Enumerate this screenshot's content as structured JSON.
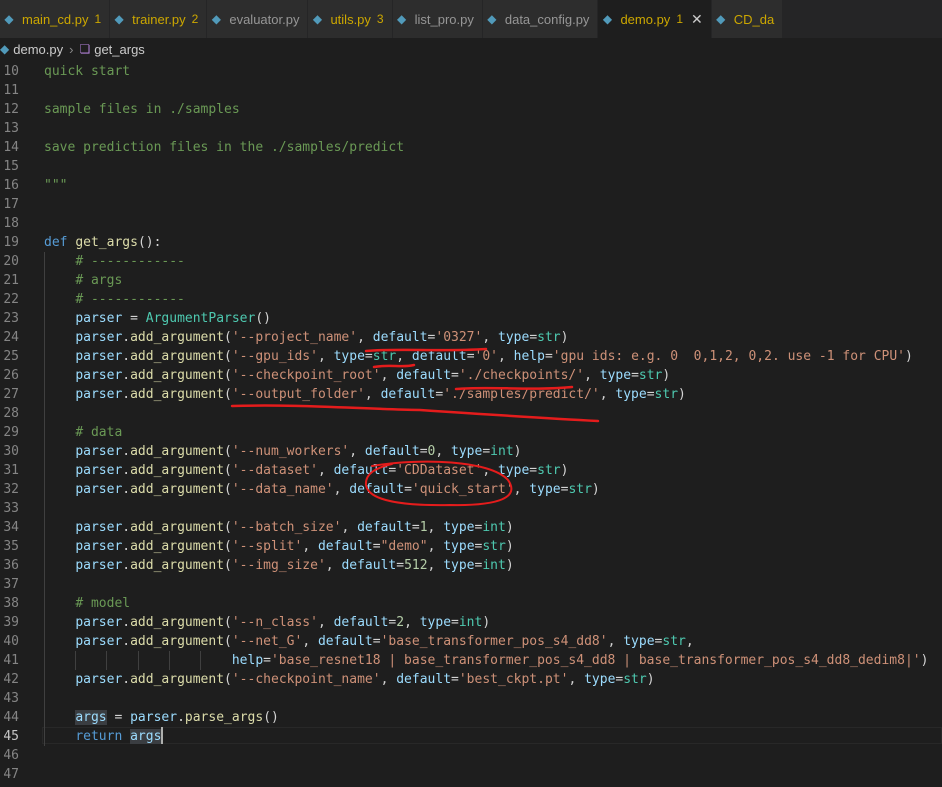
{
  "tabs": [
    {
      "label": "main_cd.py",
      "count": "1",
      "warn": true,
      "active": false
    },
    {
      "label": "trainer.py",
      "count": "2",
      "warn": true,
      "active": false
    },
    {
      "label": "evaluator.py",
      "count": "",
      "warn": false,
      "active": false
    },
    {
      "label": "utils.py",
      "count": "3",
      "warn": true,
      "active": false
    },
    {
      "label": "list_pro.py",
      "count": "",
      "warn": false,
      "active": false
    },
    {
      "label": "data_config.py",
      "count": "",
      "warn": false,
      "active": false
    },
    {
      "label": "demo.py",
      "count": "1",
      "warn": true,
      "active": true
    },
    {
      "label": "CD_da",
      "count": "",
      "warn": true,
      "active": false
    }
  ],
  "breadcrumb": {
    "file": "demo.py",
    "symbol": "get_args"
  },
  "editor": {
    "current_line": 45,
    "lines": [
      {
        "n": "10",
        "t": [
          [
            "c",
            "quick start"
          ]
        ]
      },
      {
        "n": "11",
        "t": []
      },
      {
        "n": "12",
        "t": [
          [
            "c",
            "sample files in ./samples"
          ]
        ]
      },
      {
        "n": "13",
        "t": []
      },
      {
        "n": "14",
        "t": [
          [
            "c",
            "save prediction files in the ./samples/predict"
          ]
        ]
      },
      {
        "n": "15",
        "t": []
      },
      {
        "n": "16",
        "t": [
          [
            "c",
            "\"\"\""
          ]
        ]
      },
      {
        "n": "17",
        "t": []
      },
      {
        "n": "18",
        "t": []
      },
      {
        "n": "19",
        "t": [
          [
            "k",
            "def"
          ],
          [
            "p",
            " "
          ],
          [
            "f",
            "get_args"
          ],
          [
            "p",
            "():"
          ]
        ]
      },
      {
        "n": "20",
        "g": 1,
        "t": [
          [
            "p",
            "    "
          ],
          [
            "c",
            "# ------------"
          ]
        ]
      },
      {
        "n": "21",
        "g": 1,
        "t": [
          [
            "p",
            "    "
          ],
          [
            "c",
            "# args"
          ]
        ]
      },
      {
        "n": "22",
        "g": 1,
        "t": [
          [
            "p",
            "    "
          ],
          [
            "c",
            "# ------------"
          ]
        ]
      },
      {
        "n": "23",
        "g": 1,
        "t": [
          [
            "p",
            "    "
          ],
          [
            "v",
            "parser"
          ],
          [
            "p",
            " = "
          ],
          [
            "cls",
            "ArgumentParser"
          ],
          [
            "p",
            "()"
          ]
        ]
      },
      {
        "n": "24",
        "g": 1,
        "t": [
          [
            "p",
            "    "
          ],
          [
            "v",
            "parser"
          ],
          [
            "p",
            "."
          ],
          [
            "f",
            "add_argument"
          ],
          [
            "p",
            "("
          ],
          [
            "s",
            "'--project_name'"
          ],
          [
            "p",
            ", "
          ],
          [
            "v",
            "default"
          ],
          [
            "p",
            "="
          ],
          [
            "s",
            "'0327'"
          ],
          [
            "p",
            ", "
          ],
          [
            "v",
            "type"
          ],
          [
            "p",
            "="
          ],
          [
            "cls",
            "str"
          ],
          [
            "p",
            ")"
          ]
        ]
      },
      {
        "n": "25",
        "g": 1,
        "t": [
          [
            "p",
            "    "
          ],
          [
            "v",
            "parser"
          ],
          [
            "p",
            "."
          ],
          [
            "f",
            "add_argument"
          ],
          [
            "p",
            "("
          ],
          [
            "s",
            "'--gpu_ids'"
          ],
          [
            "p",
            ", "
          ],
          [
            "v",
            "type"
          ],
          [
            "p",
            "="
          ],
          [
            "cls",
            "str"
          ],
          [
            "p",
            ", "
          ],
          [
            "v",
            "default"
          ],
          [
            "p",
            "="
          ],
          [
            "s",
            "'0'"
          ],
          [
            "p",
            ", "
          ],
          [
            "v",
            "help"
          ],
          [
            "p",
            "="
          ],
          [
            "s",
            "'gpu ids: e.g. 0  0,1,2, 0,2. use -1 for CPU'"
          ],
          [
            "p",
            ")"
          ]
        ]
      },
      {
        "n": "26",
        "g": 1,
        "t": [
          [
            "p",
            "    "
          ],
          [
            "v",
            "parser"
          ],
          [
            "p",
            "."
          ],
          [
            "f",
            "add_argument"
          ],
          [
            "p",
            "("
          ],
          [
            "s",
            "'--checkpoint_root'"
          ],
          [
            "p",
            ", "
          ],
          [
            "v",
            "default"
          ],
          [
            "p",
            "="
          ],
          [
            "s",
            "'./checkpoints/'"
          ],
          [
            "p",
            ", "
          ],
          [
            "v",
            "type"
          ],
          [
            "p",
            "="
          ],
          [
            "cls",
            "str"
          ],
          [
            "p",
            ")"
          ]
        ]
      },
      {
        "n": "27",
        "g": 1,
        "t": [
          [
            "p",
            "    "
          ],
          [
            "v",
            "parser"
          ],
          [
            "p",
            "."
          ],
          [
            "f",
            "add_argument"
          ],
          [
            "p",
            "("
          ],
          [
            "s",
            "'--output_folder'"
          ],
          [
            "p",
            ", "
          ],
          [
            "v",
            "default"
          ],
          [
            "p",
            "="
          ],
          [
            "s",
            "'./samples/predict/'"
          ],
          [
            "p",
            ", "
          ],
          [
            "v",
            "type"
          ],
          [
            "p",
            "="
          ],
          [
            "cls",
            "str"
          ],
          [
            "p",
            ")"
          ]
        ]
      },
      {
        "n": "28",
        "g": 1,
        "t": []
      },
      {
        "n": "29",
        "g": 1,
        "t": [
          [
            "p",
            "    "
          ],
          [
            "c",
            "# data"
          ]
        ]
      },
      {
        "n": "30",
        "g": 1,
        "t": [
          [
            "p",
            "    "
          ],
          [
            "v",
            "parser"
          ],
          [
            "p",
            "."
          ],
          [
            "f",
            "add_argument"
          ],
          [
            "p",
            "("
          ],
          [
            "s",
            "'--num_workers'"
          ],
          [
            "p",
            ", "
          ],
          [
            "v",
            "default"
          ],
          [
            "p",
            "="
          ],
          [
            "n",
            "0"
          ],
          [
            "p",
            ", "
          ],
          [
            "v",
            "type"
          ],
          [
            "p",
            "="
          ],
          [
            "cls",
            "int"
          ],
          [
            "p",
            ")"
          ]
        ]
      },
      {
        "n": "31",
        "g": 1,
        "t": [
          [
            "p",
            "    "
          ],
          [
            "v",
            "parser"
          ],
          [
            "p",
            "."
          ],
          [
            "f",
            "add_argument"
          ],
          [
            "p",
            "("
          ],
          [
            "s",
            "'--dataset'"
          ],
          [
            "p",
            ", "
          ],
          [
            "v",
            "default"
          ],
          [
            "p",
            "="
          ],
          [
            "s",
            "'CDDataset'"
          ],
          [
            "p",
            ", "
          ],
          [
            "v",
            "type"
          ],
          [
            "p",
            "="
          ],
          [
            "cls",
            "str"
          ],
          [
            "p",
            ")"
          ]
        ]
      },
      {
        "n": "32",
        "g": 1,
        "t": [
          [
            "p",
            "    "
          ],
          [
            "v",
            "parser"
          ],
          [
            "p",
            "."
          ],
          [
            "f",
            "add_argument"
          ],
          [
            "p",
            "("
          ],
          [
            "s",
            "'--data_name'"
          ],
          [
            "p",
            ", "
          ],
          [
            "v",
            "default"
          ],
          [
            "p",
            "="
          ],
          [
            "s",
            "'quick_start'"
          ],
          [
            "p",
            ", "
          ],
          [
            "v",
            "type"
          ],
          [
            "p",
            "="
          ],
          [
            "cls",
            "str"
          ],
          [
            "p",
            ")"
          ]
        ]
      },
      {
        "n": "33",
        "g": 1,
        "t": []
      },
      {
        "n": "34",
        "g": 1,
        "t": [
          [
            "p",
            "    "
          ],
          [
            "v",
            "parser"
          ],
          [
            "p",
            "."
          ],
          [
            "f",
            "add_argument"
          ],
          [
            "p",
            "("
          ],
          [
            "s",
            "'--batch_size'"
          ],
          [
            "p",
            ", "
          ],
          [
            "v",
            "default"
          ],
          [
            "p",
            "="
          ],
          [
            "n",
            "1"
          ],
          [
            "p",
            ", "
          ],
          [
            "v",
            "type"
          ],
          [
            "p",
            "="
          ],
          [
            "cls",
            "int"
          ],
          [
            "p",
            ")"
          ]
        ]
      },
      {
        "n": "35",
        "g": 1,
        "t": [
          [
            "p",
            "    "
          ],
          [
            "v",
            "parser"
          ],
          [
            "p",
            "."
          ],
          [
            "f",
            "add_argument"
          ],
          [
            "p",
            "("
          ],
          [
            "s",
            "'--split'"
          ],
          [
            "p",
            ", "
          ],
          [
            "v",
            "default"
          ],
          [
            "p",
            "="
          ],
          [
            "s",
            "\"demo\""
          ],
          [
            "p",
            ", "
          ],
          [
            "v",
            "type"
          ],
          [
            "p",
            "="
          ],
          [
            "cls",
            "str"
          ],
          [
            "p",
            ")"
          ]
        ]
      },
      {
        "n": "36",
        "g": 1,
        "t": [
          [
            "p",
            "    "
          ],
          [
            "v",
            "parser"
          ],
          [
            "p",
            "."
          ],
          [
            "f",
            "add_argument"
          ],
          [
            "p",
            "("
          ],
          [
            "s",
            "'--img_size'"
          ],
          [
            "p",
            ", "
          ],
          [
            "v",
            "default"
          ],
          [
            "p",
            "="
          ],
          [
            "n",
            "512"
          ],
          [
            "p",
            ", "
          ],
          [
            "v",
            "type"
          ],
          [
            "p",
            "="
          ],
          [
            "cls",
            "int"
          ],
          [
            "p",
            ")"
          ]
        ]
      },
      {
        "n": "37",
        "g": 1,
        "t": []
      },
      {
        "n": "38",
        "g": 1,
        "t": [
          [
            "p",
            "    "
          ],
          [
            "c",
            "# model"
          ]
        ]
      },
      {
        "n": "39",
        "g": 1,
        "t": [
          [
            "p",
            "    "
          ],
          [
            "v",
            "parser"
          ],
          [
            "p",
            "."
          ],
          [
            "f",
            "add_argument"
          ],
          [
            "p",
            "("
          ],
          [
            "s",
            "'--n_class'"
          ],
          [
            "p",
            ", "
          ],
          [
            "v",
            "default"
          ],
          [
            "p",
            "="
          ],
          [
            "n",
            "2"
          ],
          [
            "p",
            ", "
          ],
          [
            "v",
            "type"
          ],
          [
            "p",
            "="
          ],
          [
            "cls",
            "int"
          ],
          [
            "p",
            ")"
          ]
        ]
      },
      {
        "n": "40",
        "g": 1,
        "t": [
          [
            "p",
            "    "
          ],
          [
            "v",
            "parser"
          ],
          [
            "p",
            "."
          ],
          [
            "f",
            "add_argument"
          ],
          [
            "p",
            "("
          ],
          [
            "s",
            "'--net_G'"
          ],
          [
            "p",
            ", "
          ],
          [
            "v",
            "default"
          ],
          [
            "p",
            "="
          ],
          [
            "s",
            "'base_transformer_pos_s4_dd8'"
          ],
          [
            "p",
            ", "
          ],
          [
            "v",
            "type"
          ],
          [
            "p",
            "="
          ],
          [
            "cls",
            "str"
          ],
          [
            "p",
            ","
          ]
        ]
      },
      {
        "n": "41",
        "g": 6,
        "t": [
          [
            "p",
            "                        "
          ],
          [
            "v",
            "help"
          ],
          [
            "p",
            "="
          ],
          [
            "s",
            "'base_resnet18 | base_transformer_pos_s4_dd8 | base_transformer_pos_s4_dd8_dedim8|'"
          ],
          [
            "p",
            ")"
          ]
        ]
      },
      {
        "n": "42",
        "g": 1,
        "t": [
          [
            "p",
            "    "
          ],
          [
            "v",
            "parser"
          ],
          [
            "p",
            "."
          ],
          [
            "f",
            "add_argument"
          ],
          [
            "p",
            "("
          ],
          [
            "s",
            "'--checkpoint_name'"
          ],
          [
            "p",
            ", "
          ],
          [
            "v",
            "default"
          ],
          [
            "p",
            "="
          ],
          [
            "s",
            "'best_ckpt.pt'"
          ],
          [
            "p",
            ", "
          ],
          [
            "v",
            "type"
          ],
          [
            "p",
            "="
          ],
          [
            "cls",
            "str"
          ],
          [
            "p",
            ")"
          ]
        ]
      },
      {
        "n": "43",
        "g": 1,
        "t": []
      },
      {
        "n": "44",
        "g": 1,
        "t": [
          [
            "p",
            "    "
          ],
          [
            "v",
            "args"
          ],
          [
            "p",
            " = "
          ],
          [
            "v",
            "parser"
          ],
          [
            "p",
            "."
          ],
          [
            "f",
            "parse_args"
          ],
          [
            "p",
            "()"
          ]
        ]
      },
      {
        "n": "45",
        "g": 1,
        "t": [
          [
            "p",
            "    "
          ],
          [
            "k",
            "return"
          ],
          [
            "p",
            " "
          ],
          [
            "v",
            "args"
          ]
        ]
      },
      {
        "n": "46",
        "t": []
      },
      {
        "n": "47",
        "t": []
      }
    ]
  }
}
